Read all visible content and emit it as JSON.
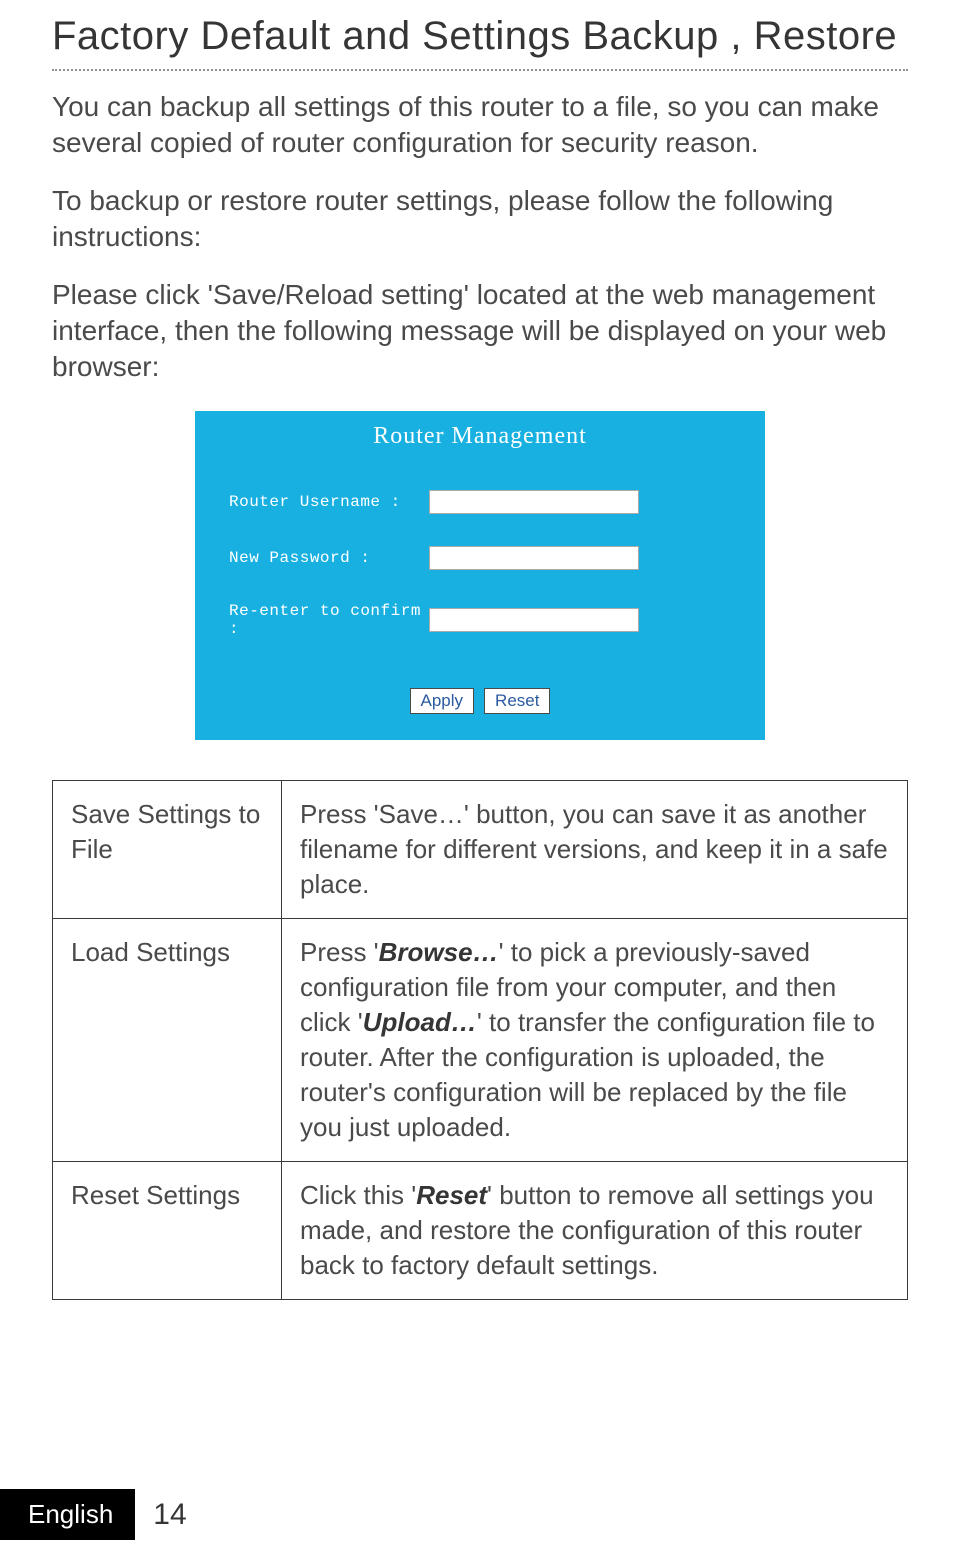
{
  "title": "Factory Default and Settings Backup , Restore",
  "para1": "You can backup all settings of this router to a file, so you can make several copied of router configuration for security reason.",
  "para2": "To backup or restore router settings, please follow the following instructions:",
  "para3": "Please click 'Save/Reload setting' located at the web management interface, then the following message will be displayed on your web browser:",
  "panel": {
    "title": "Router Management",
    "row1_label": "Router Username :",
    "row2_label": "New Password :",
    "row3_label": "Re-enter to confirm :",
    "apply": "Apply",
    "reset": "Reset"
  },
  "table": {
    "r1_l": "Save Settings to File",
    "r1_r": "Press 'Save…' button, you can save it as another filename for different versions, and keep it in a safe place.",
    "r2_l": "Load Settings",
    "r2_r_a": "Press '",
    "r2_r_b": "Browse…",
    "r2_r_c": "' to pick a previously-saved configuration file from your computer, and then click '",
    "r2_r_d": "Upload…",
    "r2_r_e": "' to transfer the configuration file to router. After the configuration is uploaded, the router's configuration will be replaced by the file you just uploaded.",
    "r3_l": "Reset Settings",
    "r3_r_a": "Click this '",
    "r3_r_b": "Reset",
    "r3_r_c": "' button to remove all settings you made, and restore the configuration of this router back to factory default settings."
  },
  "footer": {
    "lang": "English",
    "page": "14"
  }
}
